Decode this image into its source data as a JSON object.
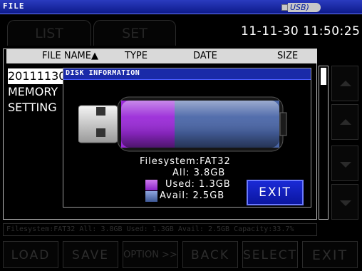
{
  "window": {
    "title": "FILE",
    "usb_label": "USB)"
  },
  "tabs": [
    {
      "label": "LIST"
    },
    {
      "label": "SET"
    }
  ],
  "clock": "11-11-30  11:50:25",
  "list": {
    "columns": {
      "name": "FILE NAME▲",
      "type": "TYPE",
      "date": "DATE",
      "size": "SIZE"
    },
    "rows": [
      {
        "name": "20111130"
      },
      {
        "name": "MEMORY"
      },
      {
        "name": "SETTING"
      }
    ]
  },
  "status_line": "Filesystem:FAT32 All: 3.8GB Used: 1.3GB Avail: 2.5GB Capacity:33.7%",
  "bottom_buttons": [
    "LOAD",
    "SAVE",
    "OPTION >>",
    "BACK",
    "SELECT",
    "EXIT"
  ],
  "side_buttons": [
    "scroll-up-icon",
    "page-up-icon",
    "page-down-icon",
    "scroll-down-icon"
  ],
  "dialog": {
    "title": "DISK INFORMATION",
    "filesystem": "Filesystem:FAT32",
    "all": "All: 3.8GB",
    "used": "Used: 1.3GB",
    "avail": "Avail: 2.5GB",
    "used_fraction": 0.34,
    "exit_label": "EXIT",
    "colors": {
      "used": "#9a2ad8",
      "avail": "#4a66a8",
      "accent": "#1a2ad6"
    }
  }
}
